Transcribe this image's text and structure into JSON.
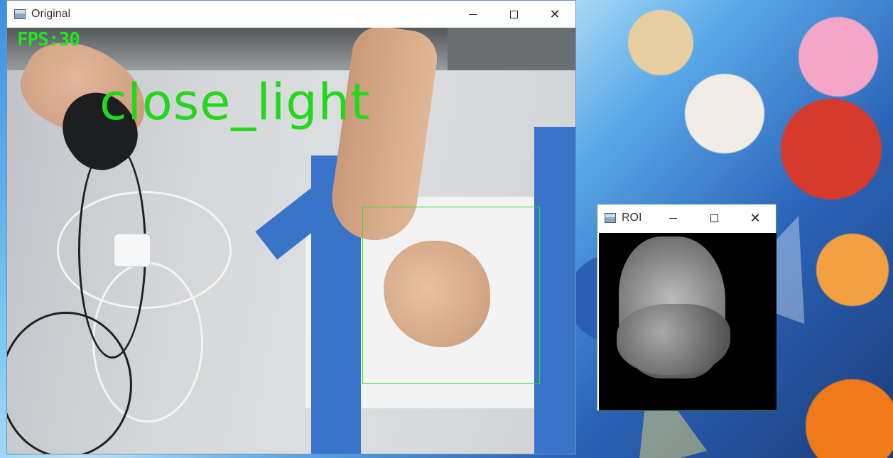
{
  "windows": {
    "original": {
      "title": "Original",
      "overlay": {
        "fps": "FPS:30",
        "gesture": "close_light"
      }
    },
    "roi": {
      "title": "ROI"
    }
  },
  "controls": {
    "minimize": "–",
    "maximize": "☐",
    "close": "✕"
  },
  "colors": {
    "overlay_text": "#22e51f",
    "roi_frame": "#2fe02a",
    "tape": "#3a74c9"
  }
}
